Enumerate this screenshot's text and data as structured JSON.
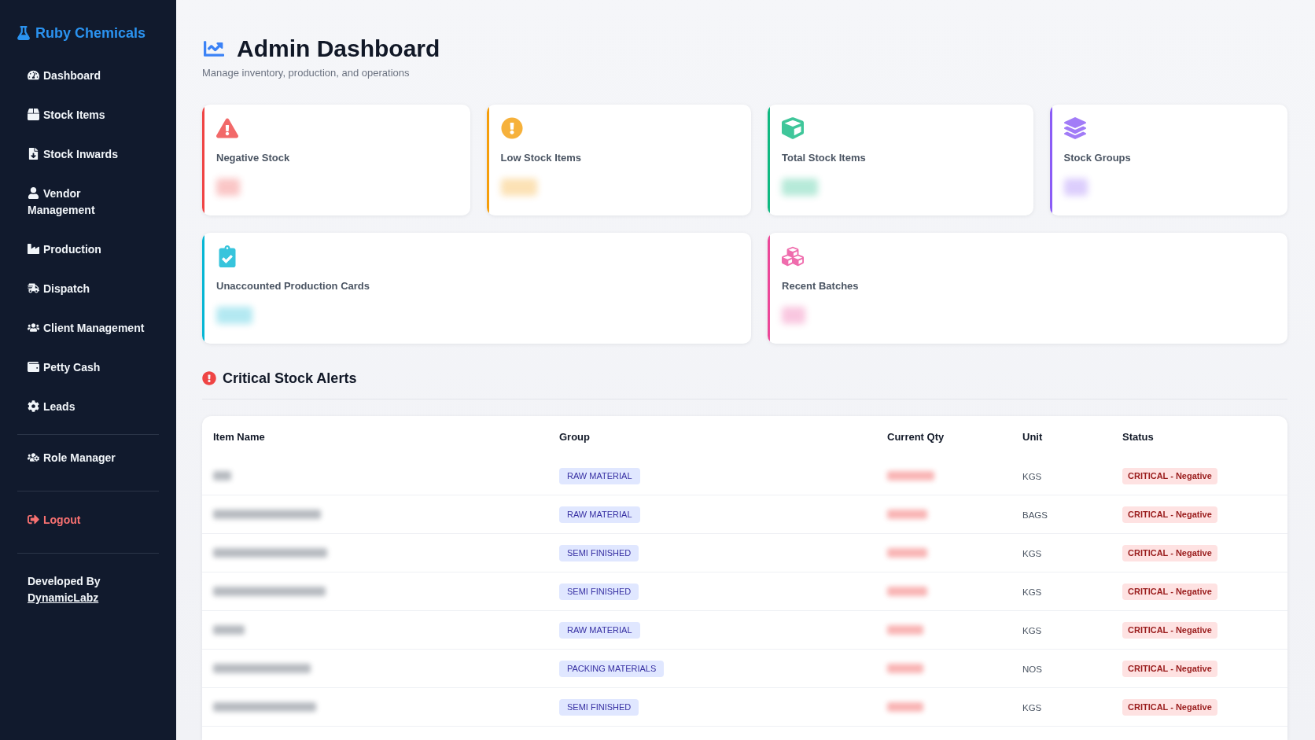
{
  "sidebar": {
    "brand": "Ruby Chemicals",
    "items": [
      "Dashboard",
      "Stock Items",
      "Stock Inwards",
      "Vendor Management",
      "Production",
      "Dispatch",
      "Client Management",
      "Petty Cash",
      "Leads"
    ],
    "admin_items": [
      "Role Manager"
    ],
    "logout": "Logout",
    "footer": {
      "text": "Developed By",
      "link": "DynamicLabz"
    }
  },
  "header": {
    "title": "Admin Dashboard",
    "subtitle": "Manage inventory, production, and operations"
  },
  "stat_cards": [
    {
      "label": "Negative Stock",
      "color": "#ef4444"
    },
    {
      "label": "Low Stock Items",
      "color": "#f59e0b"
    },
    {
      "label": "Total Stock Items",
      "color": "#10b981"
    },
    {
      "label": "Stock Groups",
      "color": "#8b5cf6"
    },
    {
      "label": "Unaccounted Production Cards",
      "color": "#06b6d4"
    },
    {
      "label": "Recent Batches",
      "color": "#ec4899"
    }
  ],
  "critical_alerts": {
    "title": "Critical Stock Alerts",
    "columns": [
      "Item Name",
      "Group",
      "Current Qty",
      "Unit",
      "Status"
    ],
    "rows": [
      {
        "group": "RAW MATERIAL",
        "unit": "KGS",
        "status": "CRITICAL - Negative"
      },
      {
        "group": "RAW MATERIAL",
        "unit": "BAGS",
        "status": "CRITICAL - Negative"
      },
      {
        "group": "SEMI FINISHED",
        "unit": "KGS",
        "status": "CRITICAL - Negative"
      },
      {
        "group": "SEMI FINISHED",
        "unit": "KGS",
        "status": "CRITICAL - Negative"
      },
      {
        "group": "RAW MATERIAL",
        "unit": "KGS",
        "status": "CRITICAL - Negative"
      },
      {
        "group": "PACKING MATERIALS",
        "unit": "NOS",
        "status": "CRITICAL - Negative"
      },
      {
        "group": "SEMI FINISHED",
        "unit": "KGS",
        "status": "CRITICAL - Negative"
      }
    ]
  }
}
